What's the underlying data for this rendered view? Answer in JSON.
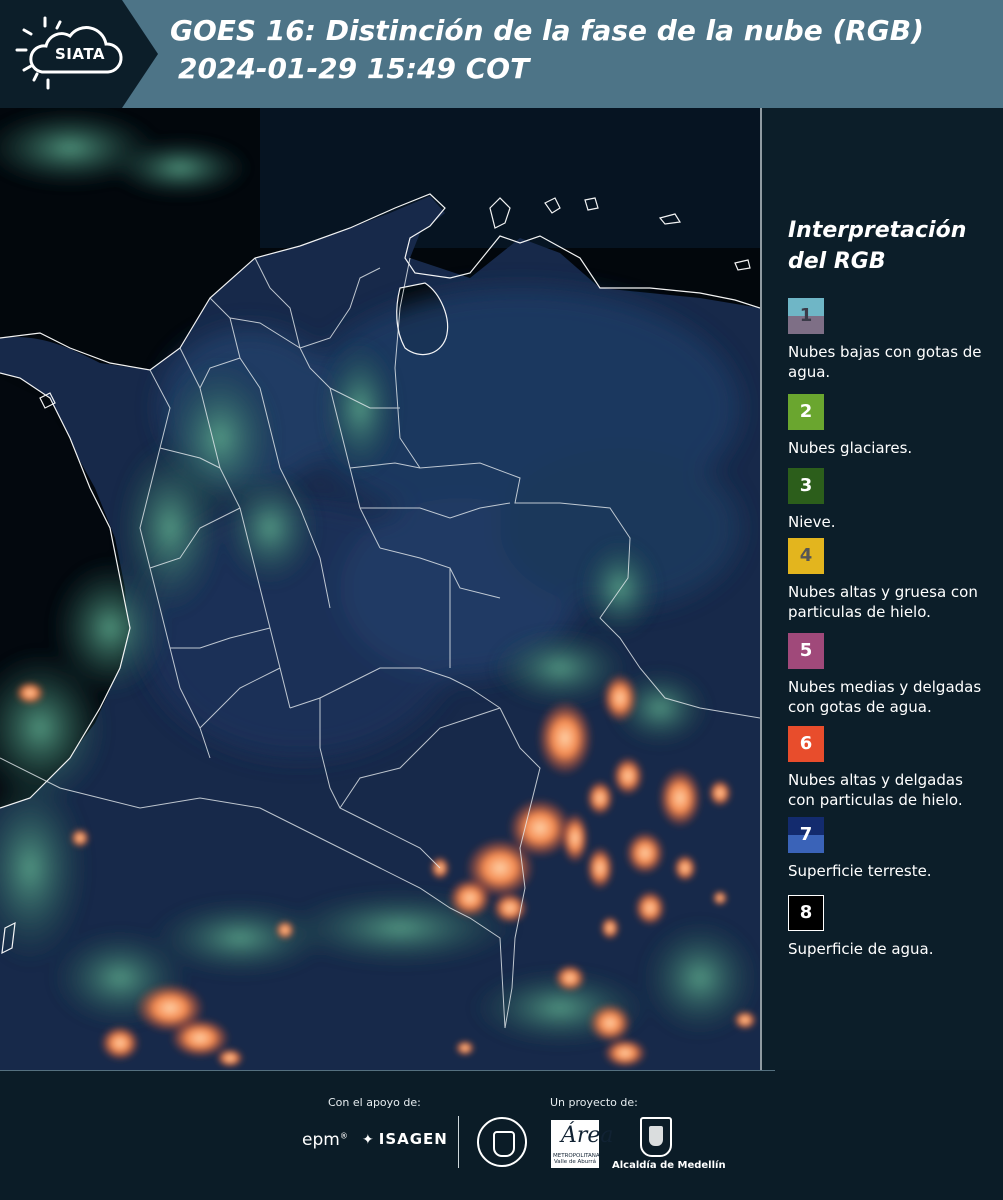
{
  "header": {
    "logo_text": "SIATA",
    "title_line1": "GOES 16: Distinción de la fase de la nube (RGB)",
    "title_line2": "2024-01-29 15:49 COT"
  },
  "legend": {
    "title_line1": "Interpretación",
    "title_line2": "del RGB",
    "items": [
      {
        "number": "1",
        "label": "Nubes bajas con gotas de agua.",
        "color_top": "#6fb6c6",
        "color_bottom": "#7e6f86",
        "number_color": "#3a3a48"
      },
      {
        "number": "2",
        "label": "Nubes glaciares.",
        "color_top": "#6aa62f",
        "color_bottom": "#6aa62f",
        "number_color": "#ffffff"
      },
      {
        "number": "3",
        "label": "Nieve.",
        "color_top": "#2c5e1b",
        "color_bottom": "#2c5e1b",
        "number_color": "#ffffff"
      },
      {
        "number": "4",
        "label": "Nubes altas y gruesa con particulas de hielo.",
        "color_top": "#e3b51e",
        "color_bottom": "#e3b51e",
        "number_color": "#555555"
      },
      {
        "number": "5",
        "label": "Nubes medias y delgadas con gotas de agua.",
        "color_top": "#a0497a",
        "color_bottom": "#a0497a",
        "number_color": "#ffffff"
      },
      {
        "number": "6",
        "label": "Nubes altas y delgadas con particulas de hielo.",
        "color_top": "#e84d2c",
        "color_bottom": "#e84d2c",
        "number_color": "#ffffff"
      },
      {
        "number": "7",
        "label": "Superficie terreste.",
        "color_top": "#132b6e",
        "color_bottom": "#3a63b8",
        "number_color": "#ffffff"
      },
      {
        "number": "8",
        "label": "Superficie de agua.",
        "color_top": "#000000",
        "color_bottom": "#000000",
        "number_color": "#ffffff"
      }
    ]
  },
  "footer": {
    "support_label": "Con el apoyo de:",
    "project_label": "Un proyecto de:",
    "epm": "epm",
    "isagen": "ISAGEN",
    "area_metro_big": "Área",
    "area_metro_small": "METROPOLITANA Valle de Aburrá",
    "medellin": "Alcaldía de Medellín"
  },
  "colors": {
    "header_bg": "#4d7487",
    "page_bg": "#0c1e29",
    "land": "#1a2c4c",
    "cloud_green": "#3e8a74",
    "cloud_orange": "#f0753e"
  }
}
